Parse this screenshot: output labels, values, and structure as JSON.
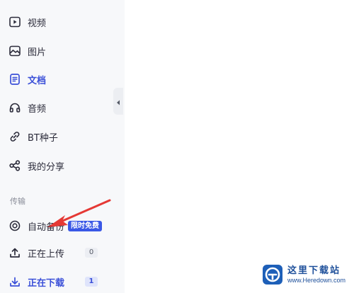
{
  "sidebar": {
    "items": [
      {
        "label": "视频",
        "icon": "video-icon"
      },
      {
        "label": "图片",
        "icon": "image-icon"
      },
      {
        "label": "文档",
        "icon": "document-icon",
        "active": true
      },
      {
        "label": "音频",
        "icon": "headphones-icon"
      },
      {
        "label": "BT种子",
        "icon": "link-icon"
      },
      {
        "label": "我的分享",
        "icon": "share-icon"
      }
    ],
    "transfer_section_label": "传输",
    "transfer_items": [
      {
        "label": "自动备份",
        "icon": "backup-icon",
        "badge": "限时免费"
      },
      {
        "label": "正在上传",
        "icon": "upload-icon",
        "count": "0"
      },
      {
        "label": "正在下载",
        "icon": "download-icon",
        "count": "1",
        "active": true
      }
    ]
  },
  "watermark": {
    "name": "这里下载站",
    "url": "www.Heredown.com"
  },
  "colors": {
    "accent": "#3a4fd8",
    "promo": "#3a58e6",
    "annotation_arrow": "#e53935",
    "sidebar_bg": "#f7f8fa"
  }
}
